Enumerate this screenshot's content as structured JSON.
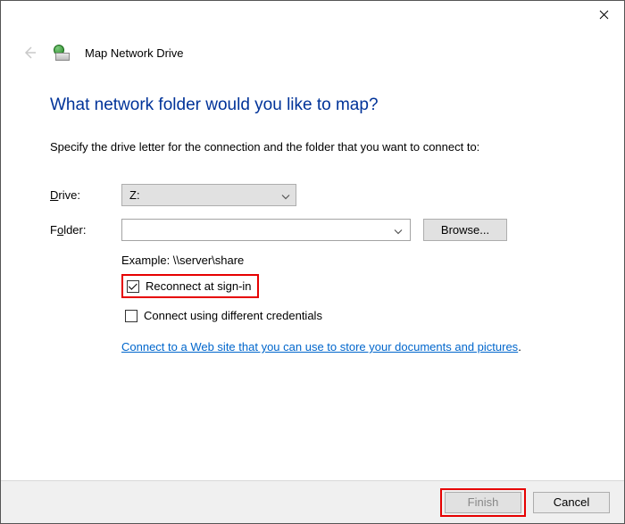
{
  "window": {
    "title": "Map Network Drive"
  },
  "heading": "What network folder would you like to map?",
  "subtext": "Specify the drive letter for the connection and the folder that you want to connect to:",
  "driveLabel": "Drive:",
  "driveValue": "Z:",
  "folderLabel": "Folder:",
  "folderValue": "",
  "browseLabel": "Browse...",
  "exampleText": "Example: \\\\server\\share",
  "reconnect": {
    "label": "Reconnect at sign-in",
    "checked": true
  },
  "credentials": {
    "label": "Connect using different credentials",
    "checked": false
  },
  "linkText": "Connect to a Web site that you can use to store your documents and pictures",
  "linkPeriod": ".",
  "footer": {
    "finish": "Finish",
    "cancel": "Cancel"
  }
}
